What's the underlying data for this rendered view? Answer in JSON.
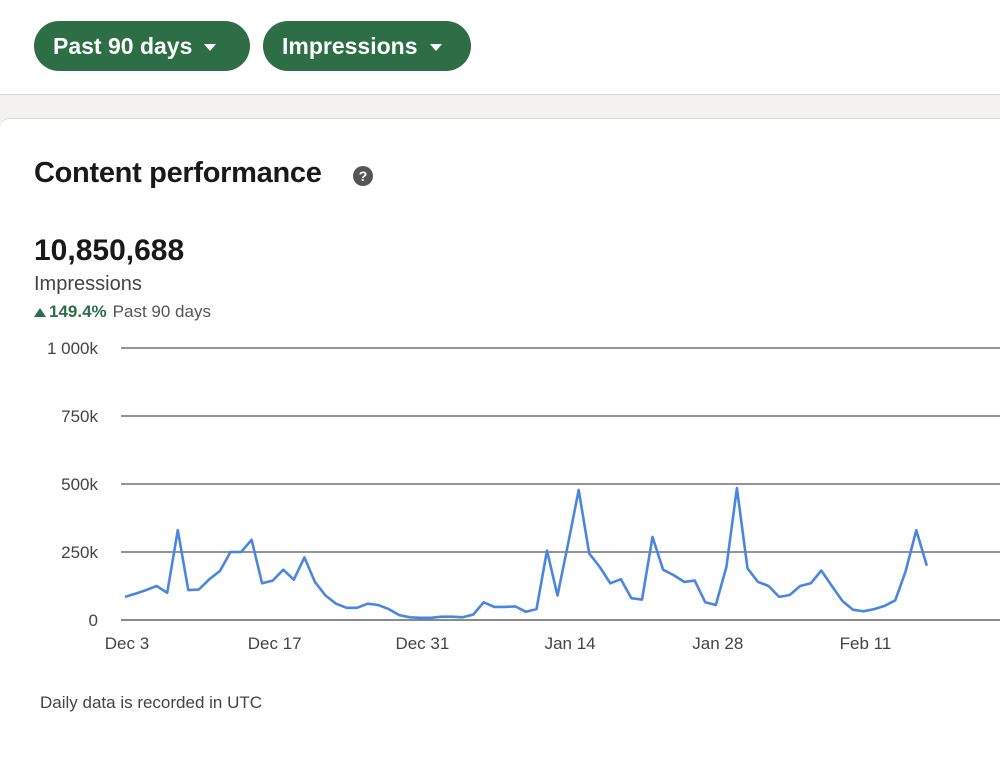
{
  "filters": {
    "range_label": "Past 90 days",
    "metric_label": "Impressions"
  },
  "card": {
    "title": "Content performance",
    "help_symbol": "?"
  },
  "summary": {
    "value": "10,850,688",
    "label": "Impressions",
    "change_pct": "149.4%",
    "change_period": "Past 90 days"
  },
  "footnote": "Daily data is recorded in UTC",
  "colors": {
    "accent_green": "#2d6e46",
    "line_blue": "#4a86e0"
  },
  "chart_data": {
    "type": "line",
    "x_ticks": [
      "Dec 3",
      "Dec 17",
      "Dec 31",
      "Jan 14",
      "Jan 28",
      "Feb 11"
    ],
    "y_ticks": [
      "0",
      "250k",
      "500k",
      "750k",
      "1 000k"
    ],
    "ylim": [
      0,
      1000000
    ],
    "grid": true,
    "series": [
      {
        "start_date": "Dec 3",
        "values": [
          85000,
          97000,
          110000,
          125000,
          100000,
          330000,
          110000,
          112000,
          150000,
          180000,
          250000,
          250000,
          295000,
          135000,
          145000,
          185000,
          148000,
          230000,
          140000,
          90000,
          60000,
          45000,
          45000,
          60000,
          55000,
          40000,
          18000,
          10000,
          8000,
          8000,
          12000,
          12000,
          10000,
          20000,
          65000,
          48000,
          48000,
          50000,
          30000,
          40000,
          255000,
          90000,
          280000,
          478000,
          245000,
          195000,
          135000,
          150000,
          80000,
          75000,
          305000,
          185000,
          165000,
          140000,
          145000,
          65000,
          55000,
          195000,
          485000,
          190000,
          140000,
          125000,
          85000,
          92000,
          125000,
          135000,
          182000,
          125000,
          70000,
          38000,
          32000,
          40000,
          52000,
          72000,
          180000,
          330000,
          200000
        ]
      }
    ]
  }
}
